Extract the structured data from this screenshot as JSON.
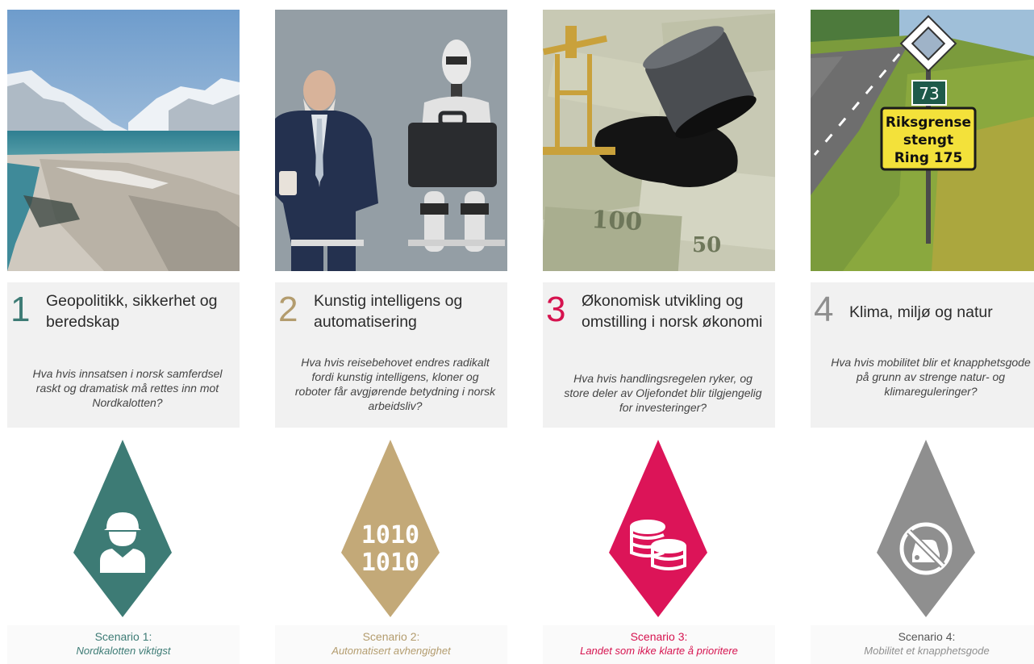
{
  "colors": {
    "teal": "#3d7b75",
    "gold": "#c3a978",
    "pink": "#dc1458",
    "grey": "#8f8f8f"
  },
  "columns": [
    {
      "number": "1",
      "title": "Geopolitikk, sikkerhet og beredskap",
      "question": "Hva hvis innsatsen i norsk samferdsel raskt og dramatisk må rettes inn mot Nordkalotten?",
      "scenario_label": "Scenario 1:",
      "scenario_name": "Nordkalotten viktigst",
      "icon": "soldier-icon"
    },
    {
      "number": "2",
      "title": "Kunstig intelligens og automatisering",
      "question": "Hva hvis reisebehovet endres radikalt fordi kunstig intelligens, kloner og roboter får avgjørende betydning i norsk arbeidsliv?",
      "scenario_label": "Scenario 2:",
      "scenario_name": "Automatisert avhengighet",
      "icon": "binary-icon",
      "icon_text": [
        "1010",
        "1010"
      ]
    },
    {
      "number": "3",
      "title": "Økonomisk utvikling og omstilling i norsk økonomi",
      "question": "Hva hvis handlingsregelen ryker, og store deler av Oljefondet blir tilgjengelig for investeringer?",
      "scenario_label": "Scenario 3:",
      "scenario_name": "Landet som ikke klarte å prioritere",
      "icon": "coins-icon"
    },
    {
      "number": "4",
      "title": "Klima, miljø og natur",
      "question": "Hva hvis mobilitet blir et knapphetsgode på grunn av strenge natur- og klimareguleringer?",
      "scenario_label": "Scenario 4:",
      "scenario_name": "Mobilitet et knapphetsgode",
      "icon": "no-car-icon"
    }
  ],
  "photos": [
    {
      "name": "arctic-beach-photo"
    },
    {
      "name": "man-and-robot-photo"
    },
    {
      "name": "oil-on-money-photo"
    },
    {
      "name": "road-sign-photo",
      "sign_number": "73",
      "sign_lines": [
        "Riksgrense",
        "stengt",
        "Ring 175"
      ]
    }
  ]
}
